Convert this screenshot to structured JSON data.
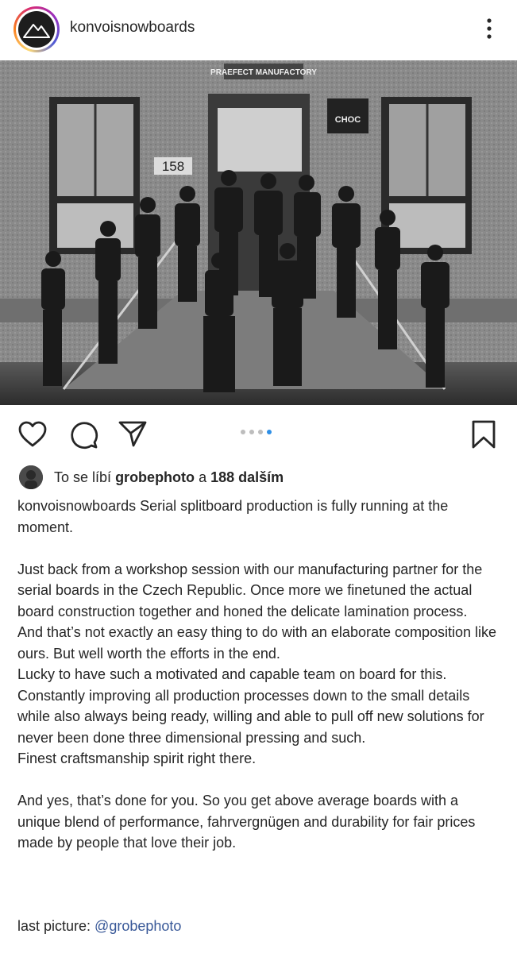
{
  "header": {
    "username": "konvoisnowboards",
    "avatar_icon": "mountain-logo-icon",
    "more_icon": "more-vertical-icon"
  },
  "post_image": {
    "alt": "",
    "sign_top": "PRAEFECT MANUFACTORY",
    "sign_brand": "CHOC",
    "house_number": "158"
  },
  "actions": {
    "like_icon": "heart-icon",
    "comment_icon": "comment-icon",
    "share_icon": "send-icon",
    "save_icon": "bookmark-icon",
    "carousel_total": 4,
    "carousel_active": 4
  },
  "likes": {
    "prefix": "To se líbí",
    "user": "grobephoto",
    "connector": "a",
    "count_text": "188 dalším"
  },
  "caption": {
    "author": "konvoisnowboards",
    "first_line": " Serial splitboard production is fully running at the moment.",
    "paragraph2": [
      "Just back from a workshop session with our manufacturing partner for the serial boards in the Czech Republic. Once more we finetuned the actual board construction together and honed the delicate lamination process.",
      "And that’s not exactly an easy thing to do with an elaborate composition like ours. But well worth the efforts in the end.",
      "Lucky to have such a motivated and capable team on board for this.",
      "Constantly improving all production processes down to the small details while also always being ready, willing and able to pull off new solutions for never been done three dimensional pressing and such.",
      "Finest craftsmanship spirit right there."
    ],
    "paragraph3": "And yes, that’s done for you. So you get above average boards with a unique blend of performance, fahrvergnügen and durability for fair prices made by people that love their job.",
    "credit_prefix": "last picture: ",
    "credit_mention": "@grobephoto"
  }
}
